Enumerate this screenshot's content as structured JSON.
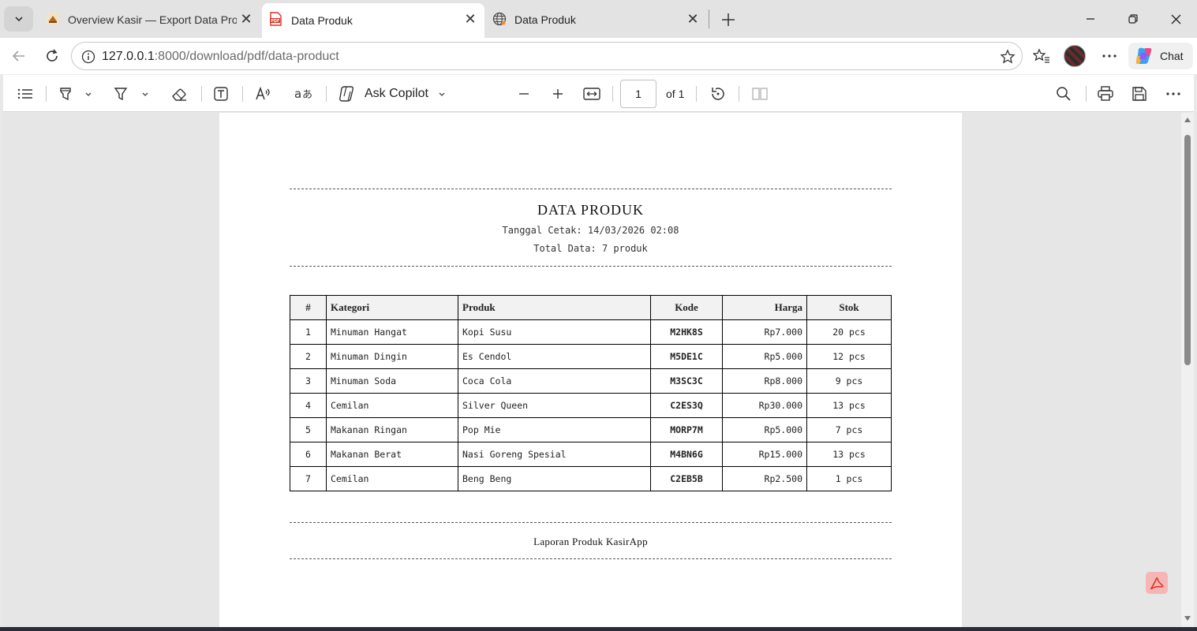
{
  "tabs": [
    {
      "title": "Overview Kasir — Export Data Produk",
      "favicon": "app-favicon"
    },
    {
      "title": "Data Produk",
      "favicon": "pdf-icon",
      "active": true
    },
    {
      "title": "Data Produk",
      "favicon": "globe-icon"
    }
  ],
  "address": {
    "host": "127.0.0.1",
    "path": ":8000/download/pdf/data-product"
  },
  "toolbar": {
    "ask_copilot": "Ask Copilot",
    "page_current": "1",
    "page_of": "of 1",
    "chat_label": "Chat"
  },
  "document": {
    "title": "DATA PRODUK",
    "printed": "Tanggal Cetak: 14/03/2026 02:08",
    "total": "Total Data: 7 produk",
    "columns": [
      "#",
      "Kategori",
      "Produk",
      "Kode",
      "Harga",
      "Stok"
    ],
    "rows": [
      [
        "1",
        "Minuman Hangat",
        "Kopi Susu",
        "M2HK8S",
        "Rp7.000",
        "20 pcs"
      ],
      [
        "2",
        "Minuman Dingin",
        "Es Cendol",
        "M5DE1C",
        "Rp5.000",
        "12 pcs"
      ],
      [
        "3",
        "Minuman Soda",
        "Coca Cola",
        "M3SC3C",
        "Rp8.000",
        "9 pcs"
      ],
      [
        "4",
        "Cemilan",
        "Silver Queen",
        "C2ES3Q",
        "Rp30.000",
        "13 pcs"
      ],
      [
        "5",
        "Makanan Ringan",
        "Pop Mie",
        "MORP7M",
        "Rp5.000",
        "7 pcs"
      ],
      [
        "6",
        "Makanan Berat",
        "Nasi Goreng Spesial",
        "M4BN6G",
        "Rp15.000",
        "13 pcs"
      ],
      [
        "7",
        "Cemilan",
        "Beng Beng",
        "C2EB5B",
        "Rp2.500",
        "1 pcs"
      ]
    ],
    "footer": "Laporan Produk KasirApp"
  },
  "colors": {
    "pdf_red": "#d93025",
    "accent": "#0f6cbd",
    "page_bg": "#ffffff",
    "viewer_bg": "#e6e6e6"
  }
}
